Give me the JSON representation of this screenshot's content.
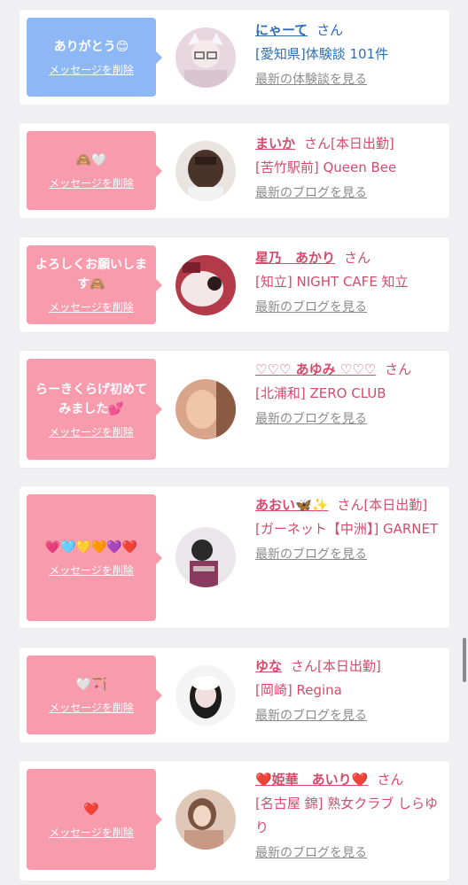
{
  "cards": [
    {
      "message": "ありがとう😊",
      "delete_label": "メッセージを削除",
      "name": "にゃーて",
      "suffix": "さん",
      "shop": "[愛知県]体験談 101件",
      "link": "最新の体験談を見る",
      "accent": "#8db7f5"
    },
    {
      "message": "🙈🤍",
      "delete_label": "メッセージを削除",
      "name": "まいか",
      "suffix": "さん[本日出勤]",
      "shop": "[苦竹駅前] Queen Bee",
      "link": "最新のブログを見る",
      "accent": "#f79bad"
    },
    {
      "message": "よろしくお願いします🙈",
      "delete_label": "メッセージを削除",
      "name": "星乃　あかり",
      "suffix": "さん",
      "shop": "[知立] NIGHT CAFE 知立",
      "link": "最新のブログを見る",
      "accent": "#f79bad"
    },
    {
      "message": "らーきくらげ初めてみました💕",
      "delete_label": "メッセージを削除",
      "name": "♡♡♡ あゆみ ♡♡♡",
      "suffix": "さん",
      "shop": "[北浦和] ZERO CLUB",
      "link": "最新のブログを見る",
      "accent": "#f79bad"
    },
    {
      "message": "💗🩵💛🧡💜❤️",
      "delete_label": "メッセージを削除",
      "name": "あおい🦋✨",
      "suffix": "さん[本日出勤]",
      "shop": "[ガーネット【中洲】] GARNET",
      "link": "最新のブログを見る",
      "accent": "#f79bad"
    },
    {
      "message": "🤍🏹",
      "delete_label": "メッセージを削除",
      "name": "ゆな",
      "suffix": "さん[本日出勤]",
      "shop": "[岡崎] Regina",
      "link": "最新のブログを見る",
      "accent": "#f79bad"
    },
    {
      "message": "❤️",
      "delete_label": "メッセージを削除",
      "name": "❤️姫華　あいり❤️",
      "suffix": "さん",
      "shop": "[名古屋 錦] 熟女クラブ しらゆり",
      "link": "最新のブログを見る",
      "accent": "#f79bad"
    }
  ]
}
